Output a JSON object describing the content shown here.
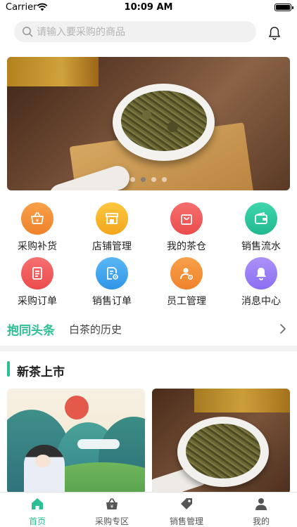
{
  "status_bar": {
    "carrier": "Carrier",
    "time": "10:09 AM"
  },
  "search": {
    "placeholder": "请输入要采购的商品"
  },
  "banner": {
    "page_count": 4,
    "active_page": 2
  },
  "quick_actions": [
    {
      "label": "采购补货",
      "icon": "basket-icon",
      "color": "#f5913a"
    },
    {
      "label": "店铺管理",
      "icon": "store-icon",
      "color": "#f7b52a"
    },
    {
      "label": "我的茶仓",
      "icon": "bag-icon",
      "color": "#f05b5b"
    },
    {
      "label": "销售流水",
      "icon": "wallet-icon",
      "color": "#2cc7a0"
    },
    {
      "label": "采购订单",
      "icon": "clipboard-icon",
      "color": "#f05b5b"
    },
    {
      "label": "销售订单",
      "icon": "document-gear-icon",
      "color": "#3ea7f0"
    },
    {
      "label": "员工管理",
      "icon": "person-gear-icon",
      "color": "#f5913a"
    },
    {
      "label": "消息中心",
      "icon": "bell-icon",
      "color": "#9b7cf5"
    }
  ],
  "headline": {
    "brand": "抱同头条",
    "text": "白茶的历史"
  },
  "section": {
    "title": "新茶上市"
  },
  "tabs": [
    {
      "label": "首页",
      "icon": "home-icon",
      "active": true
    },
    {
      "label": "采购专区",
      "icon": "basket-icon",
      "active": false
    },
    {
      "label": "销售管理",
      "icon": "tag-icon",
      "active": false
    },
    {
      "label": "我的",
      "icon": "person-icon",
      "active": false
    }
  ],
  "colors": {
    "accent": "#2bbf93",
    "inactive_tab": "#555555"
  }
}
